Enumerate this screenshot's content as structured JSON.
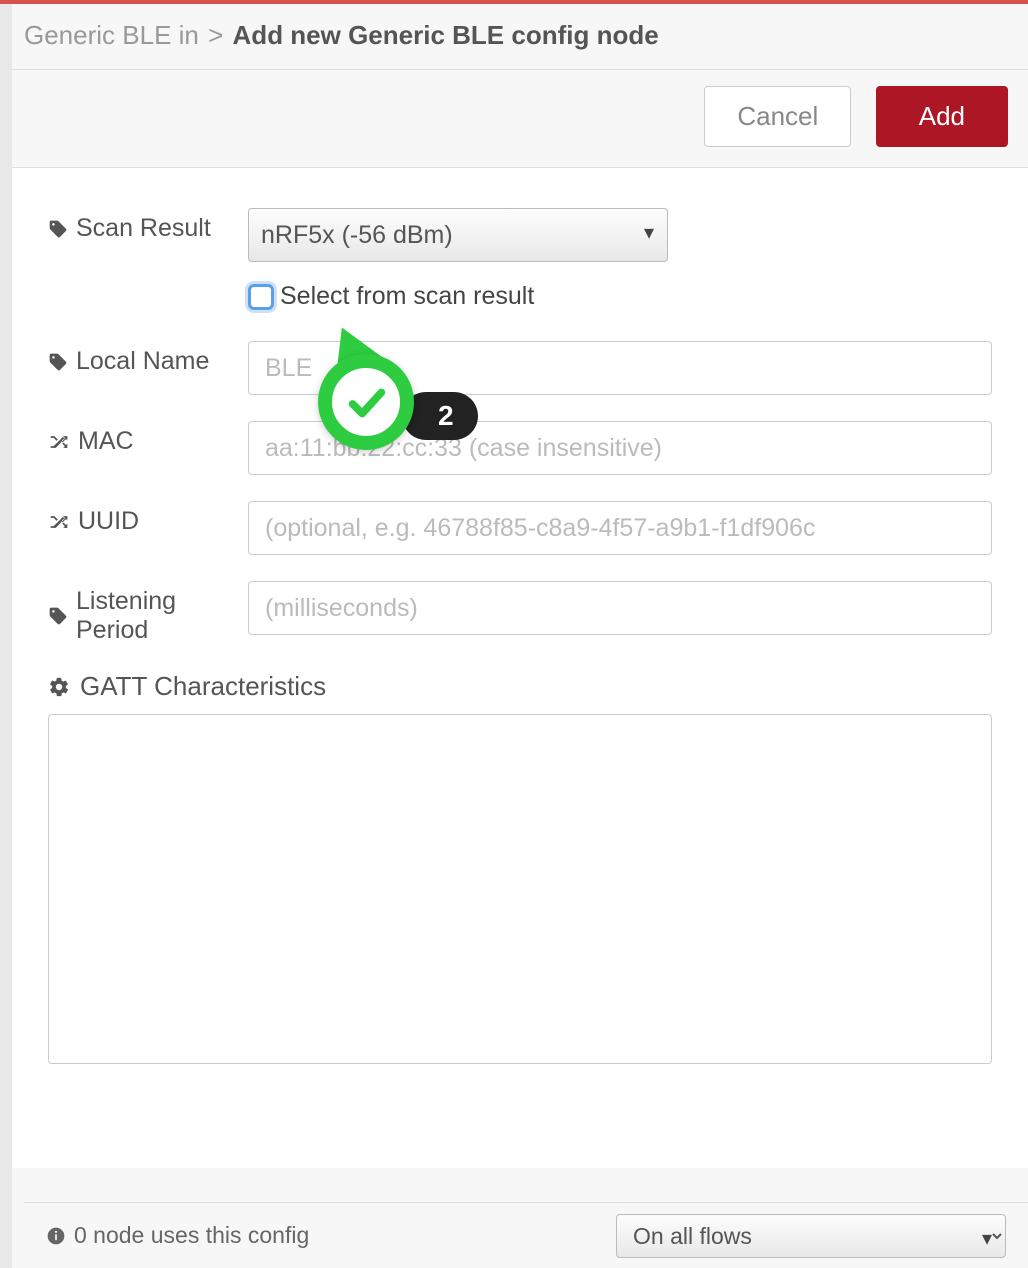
{
  "breadcrumb": {
    "parent": "Generic BLE in",
    "separator": ">",
    "current": "Add new Generic BLE config node"
  },
  "actions": {
    "cancel": "Cancel",
    "add": "Add"
  },
  "form": {
    "scanResult": {
      "label": "Scan Result",
      "selected": "nRF5x (-56 dBm)"
    },
    "selectFromScan": {
      "label": "Select from scan result",
      "checked": false
    },
    "localName": {
      "label": "Local Name",
      "placeholder": "BLE"
    },
    "mac": {
      "label": "MAC",
      "placeholder": "aa:11:bb:22:cc:33 (case insensitive)"
    },
    "uuid": {
      "label": "UUID",
      "placeholder": "(optional, e.g. 46788f85-c8a9-4f57-a9b1-f1df906c"
    },
    "listeningPeriod": {
      "label": "Listening Period",
      "placeholder": "(milliseconds)"
    },
    "gatt": {
      "label": "GATT Characteristics"
    }
  },
  "footer": {
    "usage": "0 node uses this config",
    "scope": "On all flows"
  },
  "badge": {
    "step": "2"
  }
}
